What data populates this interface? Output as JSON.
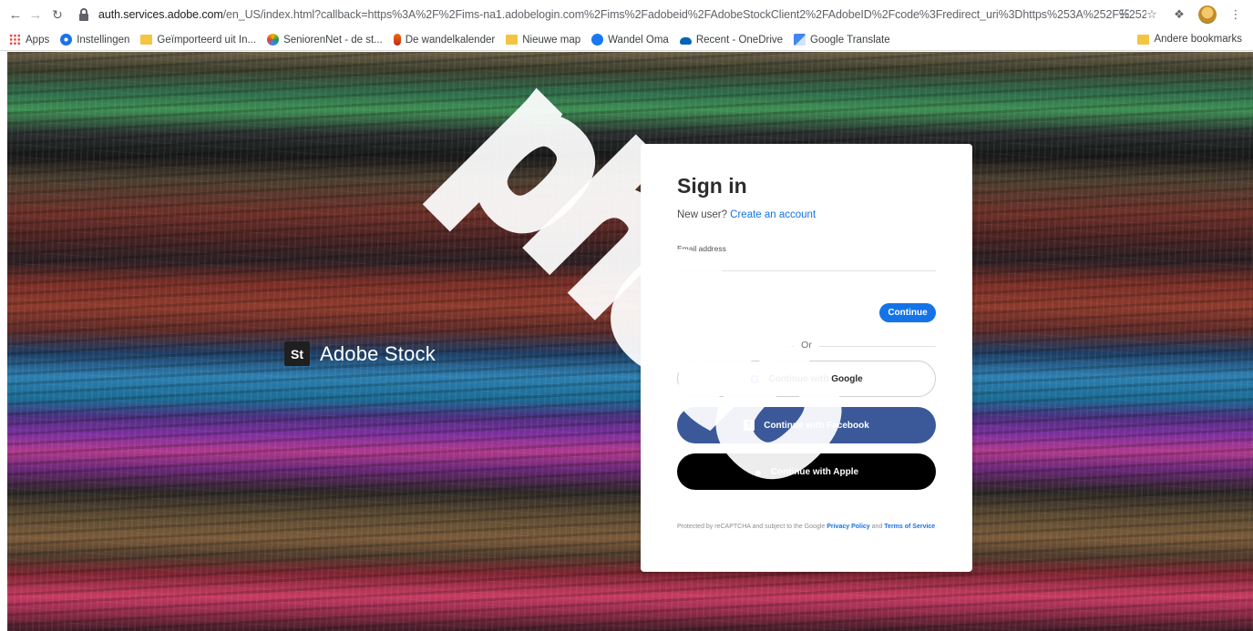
{
  "browser": {
    "url_host": "auth.services.adobe.com",
    "url_rest": "/en_US/index.html?callback=https%3A%2F%2Fims-na1.adobelogin.com%2Fims%2Fadobeid%2FAdobeStockClient2%2FAdobeID%2Fcode%3Fredirect_uri%3Dhttps%253A%252F%252Fstock.adobe.com%252Fstock-photo%252Finterloc...",
    "icons": [
      "back-arrow-icon",
      "forward-arrow-icon",
      "reload-icon",
      "lock-icon",
      "translate-icon",
      "star-icon",
      "extensions-icon",
      "profile-avatar",
      "kebab-menu-icon"
    ]
  },
  "bookmarks": {
    "items": [
      {
        "label": "Apps",
        "icon": "apps-grid-icon"
      },
      {
        "label": "Instellingen",
        "icon": "gear-icon"
      },
      {
        "label": "Geïmporteerd uit In...",
        "icon": "folder-icon"
      },
      {
        "label": "SeniorenNet - de st...",
        "icon": "seniorennet-icon"
      },
      {
        "label": "De wandelkalender",
        "icon": "wandelkalender-icon"
      },
      {
        "label": "Nieuwe map",
        "icon": "folder-icon"
      },
      {
        "label": "Wandel Oma",
        "icon": "facebook-icon"
      },
      {
        "label": "Recent - OneDrive",
        "icon": "onedrive-icon"
      },
      {
        "label": "Google Translate",
        "icon": "google-translate-icon"
      }
    ],
    "other": "Andere bookmarks"
  },
  "brand": {
    "logo": "St",
    "name": "Adobe Stock"
  },
  "signin": {
    "title": "Sign in",
    "new_user": "New user?",
    "create_account": "Create an account",
    "email_label": "Email address",
    "email_value": "",
    "continue": "Continue",
    "or": "Or",
    "google": "Continue with Google",
    "facebook": "Continue with Facebook",
    "apple": "Continue with Apple",
    "legal_prefix": "Protected by reCAPTCHA and subject to the Google",
    "privacy": "Privacy Policy",
    "and": "and",
    "terms": "Terms of Service"
  },
  "colors": {
    "accent": "#1473e6",
    "facebook": "#3b5998",
    "apple": "#000000"
  },
  "watermark": "photo"
}
